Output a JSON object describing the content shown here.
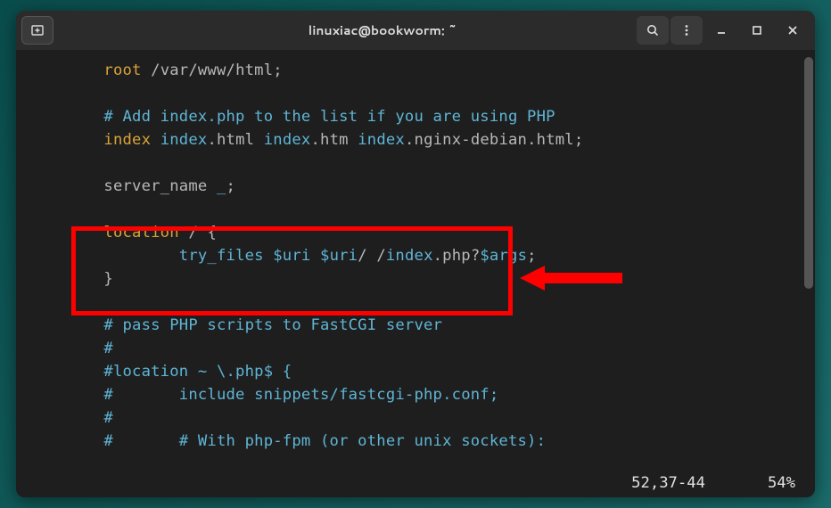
{
  "window": {
    "title": "linuxiac@bookworm: ~"
  },
  "icons": {
    "new_tab": "new-tab-icon",
    "search": "search-icon",
    "menu": "hamburger-menu-icon",
    "minimize": "minimize-icon",
    "maximize": "maximize-icon",
    "close": "close-icon"
  },
  "code": {
    "indent2": "        ",
    "indent4": "                ",
    "l1_kw": "root",
    "l1_path": " /var/www/html",
    "semi": ";",
    "blank": "",
    "l3_cmt": "# Add index.php to the list if you are using PHP",
    "l4_kw": "index",
    "l4_a": " index",
    "l4_b": ".html ",
    "l4_c": "index",
    "l4_d": ".htm ",
    "l4_e": "index",
    "l4_f": ".nginx-debian.html",
    "l6_a": "server_name ",
    "l6_b": "_",
    "l8_kw": "location",
    "l8_a": " / ",
    "l8_b": "{",
    "l9_a": "try_files ",
    "l9_b": "$uri",
    "l9_sp": " ",
    "l9_c": "$uri",
    "l9_d": "/ /",
    "l9_e": "index",
    "l9_f": ".php?",
    "l9_g": "$args",
    "l10": "}",
    "l12_cmt": "# pass PHP scripts to FastCGI server",
    "l13_cmt": "#",
    "l14_cmt": "#location ~ \\.php$ {",
    "l15_cmt": "#       include snippets/fastcgi-php.conf;",
    "l16_cmt": "#",
    "l17_cmt": "#       # With php-fpm (or other unix sockets):"
  },
  "status": {
    "pos": "52,37-44",
    "pct": "54%"
  },
  "colors": {
    "keyword": "#d9a33a",
    "identifier": "#5fb5d6",
    "text": "#b8b8b8",
    "highlight": "#ff0000",
    "bg": "#1e1e1e"
  }
}
